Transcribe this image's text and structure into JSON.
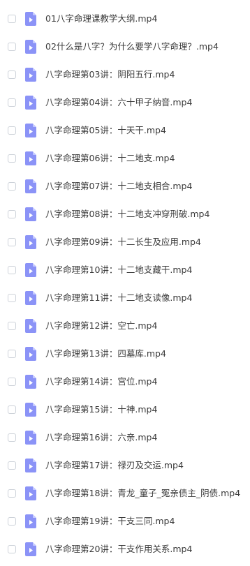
{
  "files": [
    {
      "name": "01八字命理课教学大纲.mp4",
      "icon": "video-file-icon"
    },
    {
      "name": "02什么是八字？为什么要学八字命理？.mp4",
      "icon": "video-file-icon"
    },
    {
      "name": "八字命理第03讲：阴阳五行.mp4",
      "icon": "video-file-icon"
    },
    {
      "name": "八字命理第04讲：六十甲子纳音.mp4",
      "icon": "video-file-icon"
    },
    {
      "name": "八字命理第05讲：十天干.mp4",
      "icon": "video-file-icon"
    },
    {
      "name": "八字命理第06讲：十二地支.mp4",
      "icon": "video-file-icon"
    },
    {
      "name": "八字命理第07讲：十二地支相合.mp4",
      "icon": "video-file-icon"
    },
    {
      "name": "八字命理第08讲：十二地支冲穿刑破.mp4",
      "icon": "video-file-icon"
    },
    {
      "name": "八字命理第09讲：十二长生及应用.mp4",
      "icon": "video-file-icon"
    },
    {
      "name": "八字命理第10讲：十二地支藏干.mp4",
      "icon": "video-file-icon"
    },
    {
      "name": "八字命理第11讲：十二地支读像.mp4",
      "icon": "video-file-icon"
    },
    {
      "name": "八字命理第12讲：空亡.mp4",
      "icon": "video-file-icon"
    },
    {
      "name": "八字命理第13讲：四墓库.mp4",
      "icon": "video-file-icon"
    },
    {
      "name": "八字命理第14讲：宫位.mp4",
      "icon": "video-file-icon"
    },
    {
      "name": "八字命理第15讲：十神.mp4",
      "icon": "video-file-icon"
    },
    {
      "name": "八字命理第16讲：六亲.mp4",
      "icon": "video-file-icon"
    },
    {
      "name": "八字命理第17讲：禄刃及交运.mp4",
      "icon": "video-file-icon"
    },
    {
      "name": "八字命理第18讲：青龙_童子_冤亲债主_阴债.mp4",
      "icon": "video-file-icon"
    },
    {
      "name": "八字命理第19讲：干支三同.mp4",
      "icon": "video-file-icon"
    },
    {
      "name": "八字命理第20讲：干支作用关系.mp4",
      "icon": "video-file-icon"
    }
  ],
  "colors": {
    "icon_fill": "#8b93f7",
    "icon_fold": "#c5caff",
    "icon_play": "#ffffff",
    "text": "#3b3b3b",
    "checkbox_border": "#cdd2d9"
  }
}
